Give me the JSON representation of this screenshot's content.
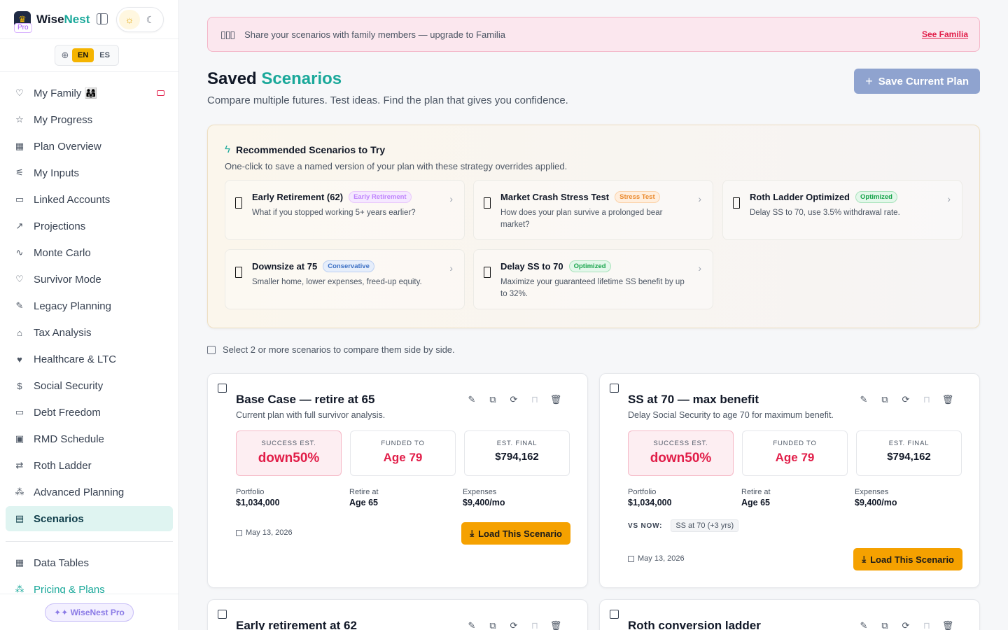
{
  "brand": {
    "name_part1": "Wise",
    "name_part2": "Nest",
    "tier_badge": "Pro",
    "logo_icon": "eagle-logo-icon"
  },
  "theme": {
    "light_icon": "sun-icon",
    "dark_icon": "moon-icon"
  },
  "language": {
    "options": [
      "EN",
      "ES"
    ],
    "selected": "EN"
  },
  "sidebar": {
    "items": [
      {
        "label": "My Family 👨‍👩‍👧",
        "icon": "heart-icon"
      },
      {
        "label": "My Progress",
        "icon": "star-icon"
      },
      {
        "label": "Plan Overview",
        "icon": "grid-icon"
      },
      {
        "label": "My Inputs",
        "icon": "sliders-icon"
      },
      {
        "label": "Linked Accounts",
        "icon": "wallet-icon"
      },
      {
        "label": "Projections",
        "icon": "trend-icon"
      },
      {
        "label": "Monte Carlo",
        "icon": "pulse-icon"
      },
      {
        "label": "Survivor Mode",
        "icon": "heart-icon"
      },
      {
        "label": "Legacy Planning",
        "icon": "feather-icon"
      },
      {
        "label": "Tax Analysis",
        "icon": "bank-icon"
      },
      {
        "label": "Healthcare & LTC",
        "icon": "heart-pulse-icon"
      },
      {
        "label": "Social Security",
        "icon": "dollar-circle-icon"
      },
      {
        "label": "Debt Freedom",
        "icon": "card-icon"
      },
      {
        "label": "RMD Schedule",
        "icon": "calendar-icon"
      },
      {
        "label": "Roth Ladder",
        "icon": "swap-icon"
      },
      {
        "label": "Advanced Planning",
        "icon": "network-icon"
      },
      {
        "label": "Scenarios",
        "icon": "save-icon",
        "active": true
      }
    ],
    "secondary": [
      {
        "label": "Data Tables",
        "icon": "table-icon"
      },
      {
        "label": "Pricing & Plans",
        "icon": "network-icon"
      }
    ],
    "footer_badge": "✦✦ WiseNest Pro"
  },
  "banner": {
    "icon": "family-icon",
    "text": "Share your scenarios with family members — upgrade to Familia",
    "link": "See Familia"
  },
  "page": {
    "title_part1": "Saved ",
    "title_part2": "Scenarios",
    "subtitle": "Compare multiple futures. Test ideas. Find the plan that gives you confidence.",
    "save_button": "Save Current Plan"
  },
  "recommended": {
    "title": "Recommended Scenarios to Try",
    "subtitle": "One-click to save a named version of your plan with these strategy overrides applied.",
    "items": [
      {
        "title": "Early Retirement (62)",
        "tag": "Early Retirement",
        "tag_color": "#c084fc",
        "desc": "What if you stopped working 5+ years earlier?"
      },
      {
        "title": "Market Crash Stress Test",
        "tag": "Stress Test",
        "tag_color": "#ea8a2e",
        "desc": "How does your plan survive a prolonged bear market?"
      },
      {
        "title": "Roth Ladder Optimized",
        "tag": "Optimized",
        "tag_color": "#16a34a",
        "desc": "Delay SS to 70, use 3.5% withdrawal rate."
      },
      {
        "title": "Downsize at 75",
        "tag": "Conservative",
        "tag_color": "#3b6fc4",
        "desc": "Smaller home, lower expenses, freed-up equity."
      },
      {
        "title": "Delay SS to 70",
        "tag": "Optimized",
        "tag_color": "#16a34a",
        "desc": "Maximize your guaranteed lifetime SS benefit by up to 32%."
      }
    ]
  },
  "select_note": "Select 2 or more scenarios to compare them side by side.",
  "scenarios": [
    {
      "title": "Base Case — retire at 65",
      "desc": "Current plan with full survivor analysis.",
      "metrics": [
        {
          "label": "SUCCESS EST.",
          "value": "down50%"
        },
        {
          "label": "FUNDED TO",
          "value": "Age 79"
        },
        {
          "label": "EST. FINAL",
          "value": "$794,162"
        }
      ],
      "kv": [
        {
          "label": "Portfolio",
          "value": "$1,034,000"
        },
        {
          "label": "Retire at",
          "value": "Age 65"
        },
        {
          "label": "Expenses",
          "value": "$9,400/mo"
        }
      ],
      "date": "May 13, 2026",
      "load_button": "Load This Scenario"
    },
    {
      "title": "SS at 70 — max benefit",
      "desc": "Delay Social Security to age 70 for maximum benefit.",
      "metrics": [
        {
          "label": "SUCCESS EST.",
          "value": "down50%"
        },
        {
          "label": "FUNDED TO",
          "value": "Age 79"
        },
        {
          "label": "EST. FINAL",
          "value": "$794,162"
        }
      ],
      "kv": [
        {
          "label": "Portfolio",
          "value": "$1,034,000"
        },
        {
          "label": "Retire at",
          "value": "Age 65"
        },
        {
          "label": "Expenses",
          "value": "$9,400/mo"
        }
      ],
      "vs_now_label": "VS NOW:",
      "vs_now_chip": "SS at 70 (+3 yrs)",
      "date": "May 13, 2026",
      "load_button": "Load This Scenario"
    },
    {
      "title": "Early retirement at 62"
    },
    {
      "title": "Roth conversion ladder"
    }
  ]
}
